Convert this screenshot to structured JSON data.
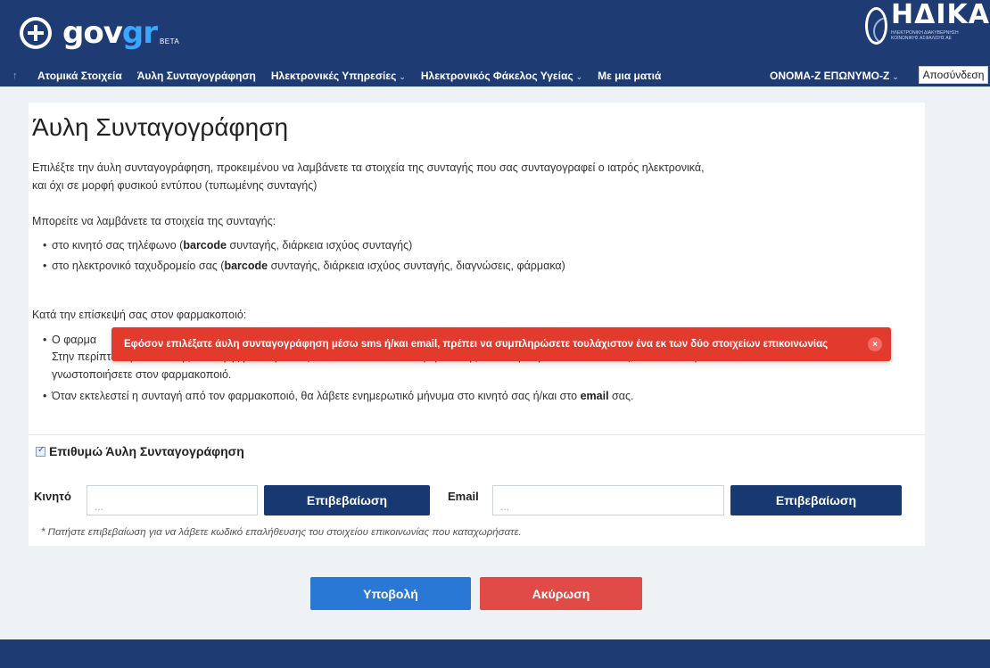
{
  "header": {
    "logo_gov": "gov",
    "logo_gr": "gr",
    "beta": "BETA",
    "partner_name": "ΗΔΙΚΑ",
    "partner_sub": "ΗΛΕΚΤΡΟΝΙΚΗ ΔΙΑΚΥΒΕΡΝΗΣΗ ΚΟΙΝΩΝΙΚΗΣ ΑΣΦΑΛΙΣΗΣ ΑΕ",
    "colors": {
      "bar": "#1f3b73",
      "accent": "#3ba6ff"
    }
  },
  "nav": {
    "items": [
      {
        "label": "Ατομικά Στοιχεία"
      },
      {
        "label": "Άυλη Συνταγογράφηση"
      },
      {
        "label": "Ηλεκτρονικές Υπηρεσίες"
      },
      {
        "label": "Ηλεκτρονικός Φάκελος Υγείας"
      },
      {
        "label": "Με μια ματιά"
      }
    ],
    "user": "ΟΝΟΜΑ-Ζ ΕΠΩΝΥΜΟ-Ζ",
    "logout": "Αποσύνδεση"
  },
  "main": {
    "title": "Άυλη Συνταγογράφηση",
    "intro_1": "Επιλέξτε την άυλη συνταγογράφηση, προκειμένου να λαμβάνετε τα στοιχεία της συνταγής που σας συνταγογραφεί ο ιατρός ηλεκτρονικά,",
    "intro_2": "και όχι σε μορφή φυσικού εντύπου (τυπωμένης συνταγής)",
    "receive_heading": "Μπορείτε να λαμβάνετε τα στοιχεία της συνταγής:",
    "receive_items": [
      {
        "pre": "στο κινητό σας τηλέφωνο (",
        "bold": "barcode",
        "post": " συνταγής, διάρκεια ισχύος συνταγής)"
      },
      {
        "pre": "στο ηλεκτρονικό ταχυδρομείο σας (",
        "bold": "barcode",
        "post": " συνταγής, διάρκεια ισχύος συνταγής, διαγνώσεις, φάρμακα)"
      }
    ],
    "visit_heading": "Κατά την επίσκεψή σας στον φαρμακοποιό:",
    "visit_1_start": "Ο φαρμα",
    "visit_1_cont": "Στην περίπτωση αποστολής συνταγής με κινητό σας αποστέλλει κωδικό επιβεβαίωσης στο κινητό ή/και στο email σας, τον οποίο πρέπει να",
    "visit_1_end": "γνωστοποιήσετε στον φαρμακοποιό.",
    "visit_2_pre": "Όταν εκτελεστεί η συνταγή από τον φαρμακοποιό, θα λάβετε ενημερωτικό μήνυμα στο κινητό σας ή/και στο ",
    "visit_2_bold": "email",
    "visit_2_post": " σας.",
    "checkbox_label": "Επιθυμώ Άυλη Συνταγογράφηση",
    "mobile_label": "Κινητό",
    "mobile_placeholder": "...",
    "email_label": "Email",
    "email_placeholder": "...",
    "confirm_label": "Επιβεβαίωση",
    "hint": "* Πατήστε επιβεβαίωση για να λάβετε κωδικό επαλήθευσης του στοιχείου επικοινωνίας που καταχωρήσατε."
  },
  "toast": {
    "message": "Εφόσον επιλέξατε άυλη συνταγογράφηση μέσω sms ή/και email, πρέπει να συμπληρώσετε τουλάχιστον ένα εκ των δύο στοιχείων επικοινωνίας",
    "close": "×",
    "color": "#e23b2e"
  },
  "actions": {
    "submit": "Υποβολή",
    "cancel": "Ακύρωση"
  }
}
